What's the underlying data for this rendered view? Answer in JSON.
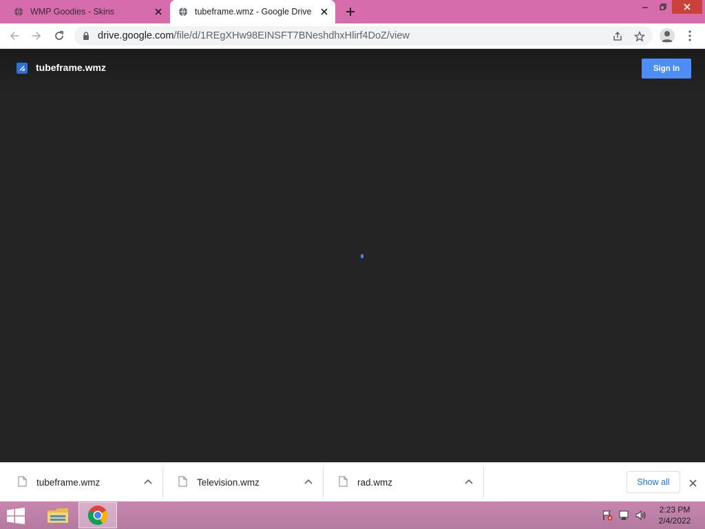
{
  "browser": {
    "tabs": [
      {
        "title": "WMP Goodies - Skins",
        "active": false
      },
      {
        "title": "tubeframe.wmz - Google Drive",
        "active": true
      }
    ],
    "url_host": "drive.google.com",
    "url_path": "/file/d/1REgXHw98EINSFT7BNeshdhxHlirf4DoZ/view",
    "accent": "#d66cab"
  },
  "viewer": {
    "file_title": "tubeframe.wmz",
    "signin_label": "Sign In",
    "background": "#242424",
    "button_color": "#4d8ef6"
  },
  "downloads": {
    "items": [
      {
        "name": "tubeframe.wmz"
      },
      {
        "name": "Television.wmz"
      },
      {
        "name": "rad.wmz"
      }
    ],
    "show_all_label": "Show all"
  },
  "taskbar": {
    "time": "2:23 PM",
    "date": "2/4/2022",
    "apps": [
      "file-explorer-icon",
      "chrome-icon"
    ]
  }
}
